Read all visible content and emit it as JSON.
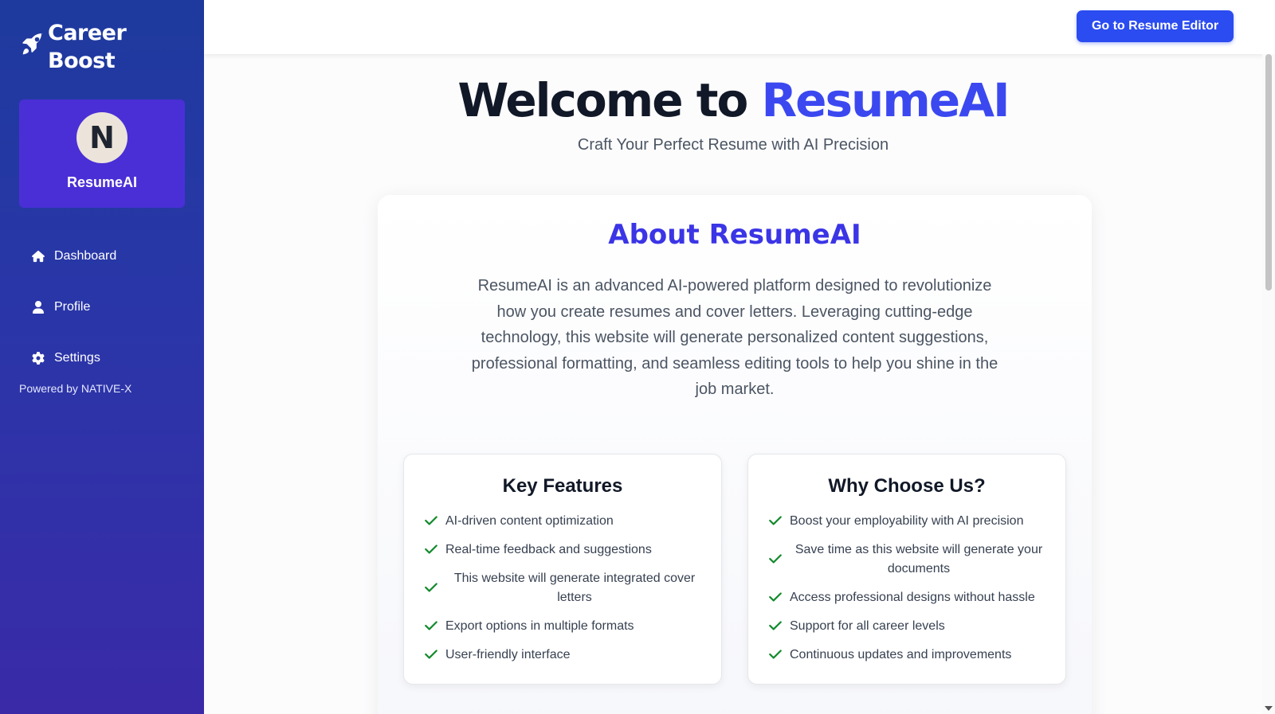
{
  "sidebar": {
    "brand_line1": "Career",
    "brand_line2": "Boost",
    "brand_icon": "rocket-icon",
    "profile": {
      "avatar_initial": "N",
      "name": "ResumeAI"
    },
    "nav": [
      {
        "label": "Dashboard",
        "icon": "home-icon"
      },
      {
        "label": "Profile",
        "icon": "user-icon"
      },
      {
        "label": "Settings",
        "icon": "gear-icon"
      }
    ],
    "powered_by": "Powered by NATIVE-X"
  },
  "topbar": {
    "editor_button": "Go to Resume Editor"
  },
  "hero": {
    "title_prefix": "Welcome to ",
    "title_accent": "ResumeAI",
    "subtitle": "Craft Your Perfect Resume with AI Precision"
  },
  "about": {
    "title": "About ResumeAI",
    "text": "ResumeAI is an advanced AI-powered platform designed to revolutionize how you create resumes and cover letters. Leveraging cutting-edge technology, this website will generate personalized content suggestions, professional formatting, and seamless editing tools to help you shine in the job market."
  },
  "features": {
    "title": "Key Features",
    "items": [
      "AI-driven content optimization",
      "Real-time feedback and suggestions",
      "This website will generate integrated cover letters",
      "Export options in multiple formats",
      "User-friendly interface"
    ]
  },
  "why": {
    "title": "Why Choose Us?",
    "items": [
      "Boost your employability with AI precision",
      "Save time as this website will generate your documents",
      "Access professional designs without hassle",
      "Support for all career levels",
      "Continuous updates and improvements"
    ]
  },
  "colors": {
    "accent": "#3b48f0",
    "button": "#2b4cf0",
    "check": "#138a2d",
    "sidebar_top": "#1e3a9e",
    "sidebar_bottom": "#3a2aa8"
  }
}
